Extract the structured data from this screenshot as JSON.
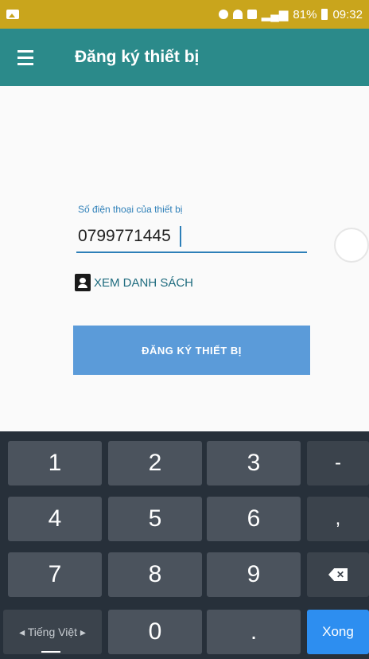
{
  "status_bar": {
    "battery": "81%",
    "time": "09:32"
  },
  "app_bar": {
    "title": "Đăng ký thiết bị"
  },
  "form": {
    "phone_label": "Số điện thoại của thiết bị",
    "phone_value": "0799771445",
    "contacts_link": "XEM DANH SÁCH",
    "register_button": "ĐĂNG KÝ THIẾT BỊ"
  },
  "keyboard": {
    "rows": [
      [
        "1",
        "2",
        "3",
        "-"
      ],
      [
        "4",
        "5",
        "6",
        ","
      ],
      [
        "7",
        "8",
        "9",
        "⌫"
      ],
      [
        "◂ Tiếng Việt ▸",
        "0",
        ".",
        "Xong"
      ]
    ]
  },
  "colors": {
    "status_bar": "#c9a51c",
    "app_bar": "#2b8a8a",
    "accent": "#2d7fb8",
    "button": "#5b9bd9",
    "keyboard": "#27303a",
    "done_key": "#2d8ef0"
  }
}
